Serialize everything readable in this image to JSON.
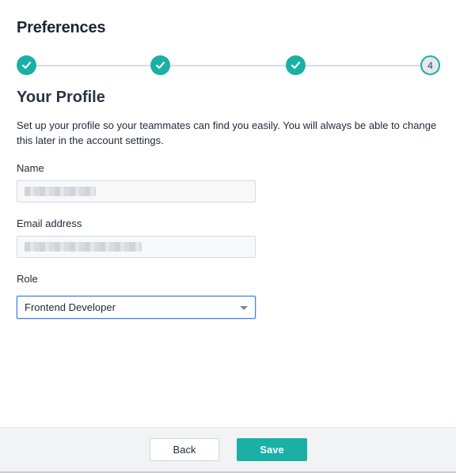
{
  "header": {
    "title": "Preferences"
  },
  "stepper": {
    "steps": [
      {
        "state": "complete",
        "icon": "check-icon"
      },
      {
        "state": "complete",
        "icon": "check-icon"
      },
      {
        "state": "complete",
        "icon": "check-icon"
      },
      {
        "state": "current",
        "label": "4"
      }
    ],
    "accent_color": "#1ab0a5"
  },
  "profile": {
    "title": "Your Profile",
    "description": "Set up your profile so your teammates can find you easily. You will always be able to change this later in the account settings."
  },
  "form": {
    "name": {
      "label": "Name",
      "value": ""
    },
    "email": {
      "label": "Email address",
      "value": ""
    },
    "role": {
      "label": "Role",
      "selected": "Frontend Developer"
    }
  },
  "footer": {
    "back_label": "Back",
    "save_label": "Save"
  }
}
